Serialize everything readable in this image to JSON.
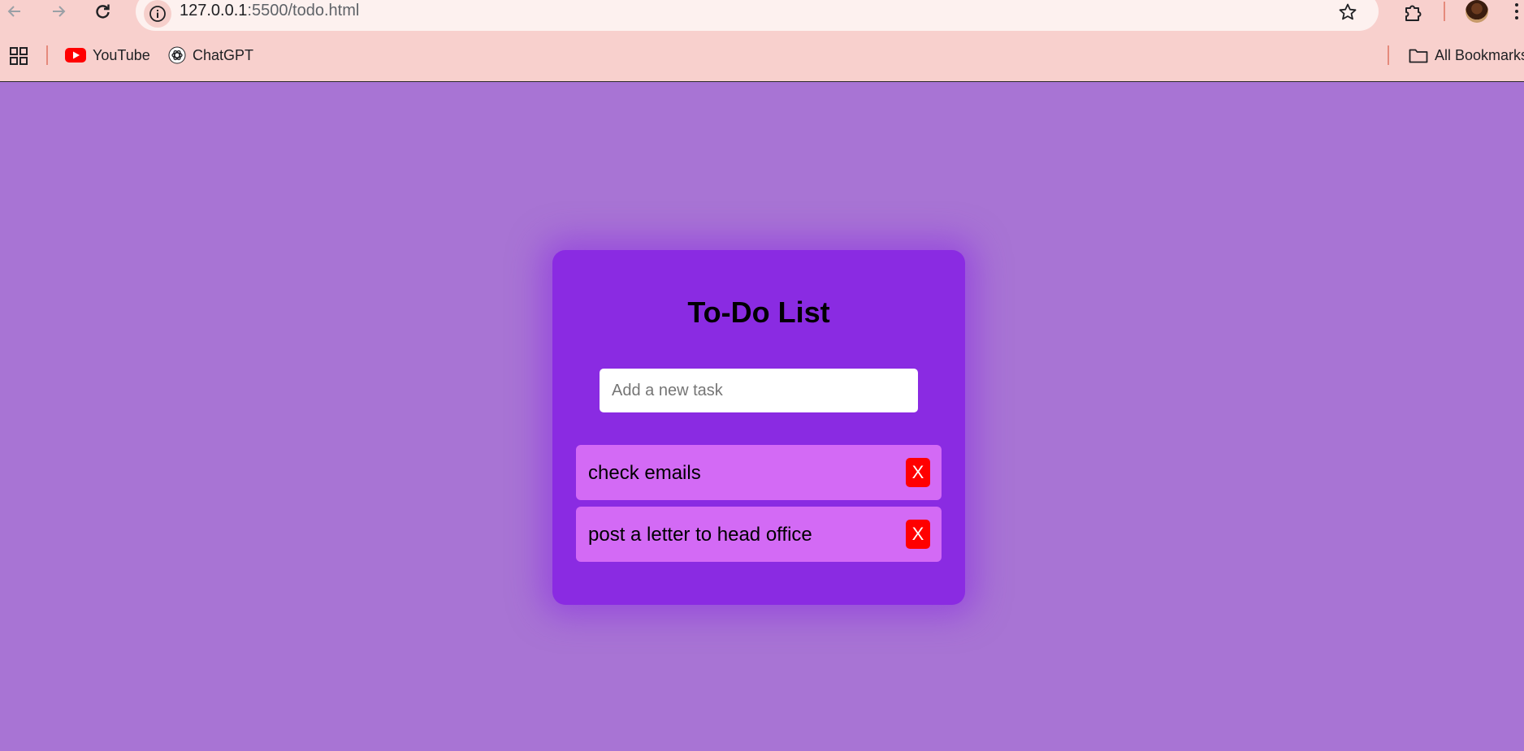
{
  "browser": {
    "url_host": "127.0.0.1",
    "url_path": ":5500/todo.html",
    "bookmarks": [
      {
        "label": "YouTube",
        "icon": "youtube-icon"
      },
      {
        "label": "ChatGPT",
        "icon": "chatgpt-icon"
      }
    ],
    "all_bookmarks_label": "All Bookmarks",
    "colors": {
      "chrome_bg": "#f8d0cd",
      "omnibox_bg": "#fdf1ef"
    }
  },
  "app": {
    "title": "To-Do List",
    "input": {
      "placeholder": "Add a new task",
      "value": ""
    },
    "tasks": [
      {
        "text": "check emails",
        "delete_label": "X"
      },
      {
        "text": "post a letter to head office",
        "delete_label": "X"
      }
    ],
    "colors": {
      "page_bg": "#a874d4",
      "card_bg": "#8a2be2",
      "task_bg": "#d36af5",
      "delete_bg": "#ff0000"
    }
  }
}
